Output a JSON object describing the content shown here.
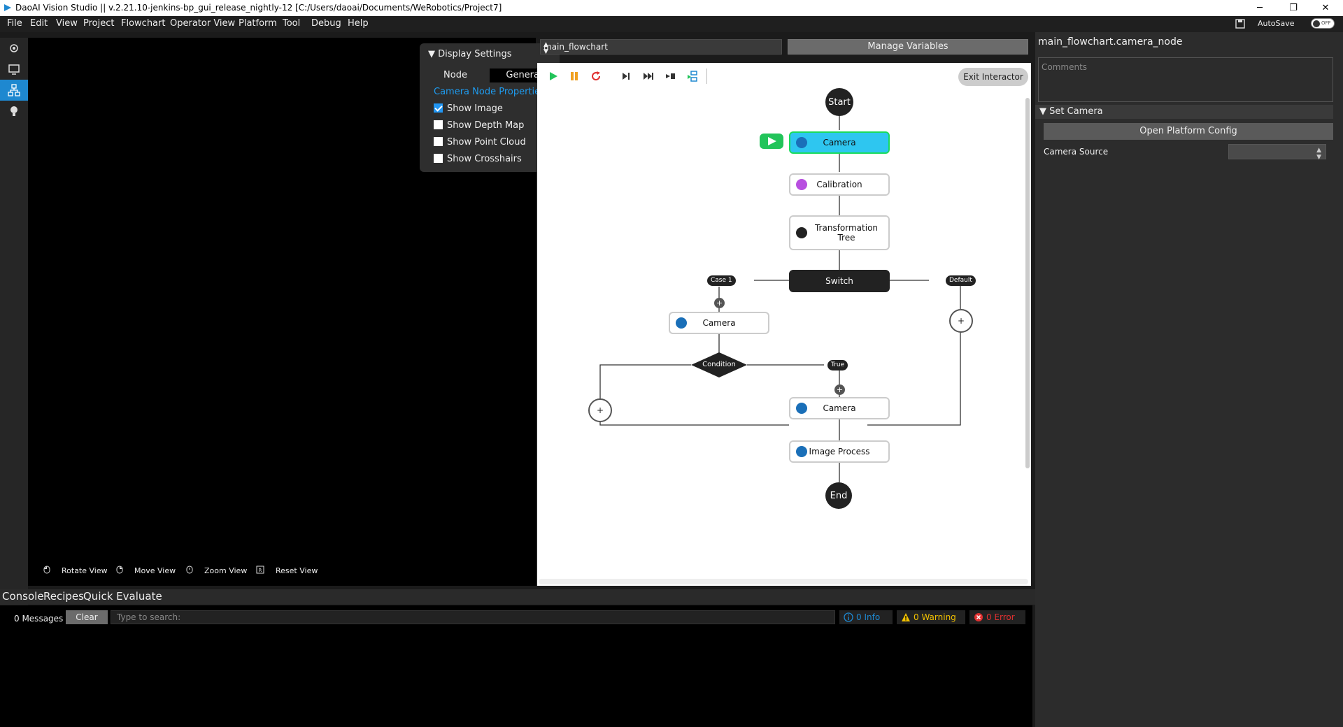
{
  "titlebar": {
    "title": "DaoAI Vision Studio || v.2.21.10-jenkins-bp_gui_release_nightly-12   [C:/Users/daoai/Documents/WeRobotics/Project7]",
    "minimize": "─",
    "maximize": "❐",
    "close": "✕"
  },
  "menu": [
    "File",
    "Edit",
    "View",
    "Project",
    "Flowchart",
    "Operator View",
    "Platform",
    "Tool",
    "Debug",
    "Help"
  ],
  "autosave": {
    "label": "AutoSave",
    "state": "OFF"
  },
  "display_settings": {
    "header": "Display Settings",
    "tabs": [
      "Node",
      "General"
    ],
    "section": "Camera Node Properties",
    "options": [
      {
        "label": "Show Image",
        "checked": true
      },
      {
        "label": "Show Depth Map",
        "checked": false
      },
      {
        "label": "Show Point Cloud",
        "checked": false
      },
      {
        "label": "Show Crosshairs",
        "checked": false
      }
    ]
  },
  "view_hints": [
    "Rotate View",
    "Move View",
    "Zoom View",
    "Reset View"
  ],
  "flowchart": {
    "selector": "main_flowchart",
    "manage_variables": "Manage Variables",
    "exit_interactor": "Exit Interactor",
    "nodes": {
      "start": "Start",
      "camera1": "Camera",
      "calibration": "Calibration",
      "transformation": "Transformation Tree",
      "switch": "Switch",
      "case1": "Case 1",
      "default": "Default",
      "camera2": "Camera",
      "condition": "Condition",
      "true": "True",
      "camera3": "Camera",
      "image_process": "Image Process",
      "end": "End",
      "plus": "+"
    },
    "icon_colors": {
      "camera": "#1a6fb8",
      "calibration": "#b84fe0",
      "transform": "#222222",
      "run": "#22c45a",
      "accent": "#1e88d0"
    }
  },
  "properties": {
    "title": "main_flowchart.camera_node",
    "comments_placeholder": "Comments",
    "section": "Set Camera",
    "open_platform_config": "Open Platform Config",
    "camera_source_label": "Camera Source",
    "camera_source_value": ""
  },
  "bottom_tabs": [
    "Console",
    "Recipes",
    "Quick Evaluate"
  ],
  "console": {
    "messages": "0 Messages",
    "clear": "Clear",
    "search_placeholder": "Type to search:",
    "info": "0 Info",
    "warning": "0 Warning",
    "error": "0 Error"
  }
}
